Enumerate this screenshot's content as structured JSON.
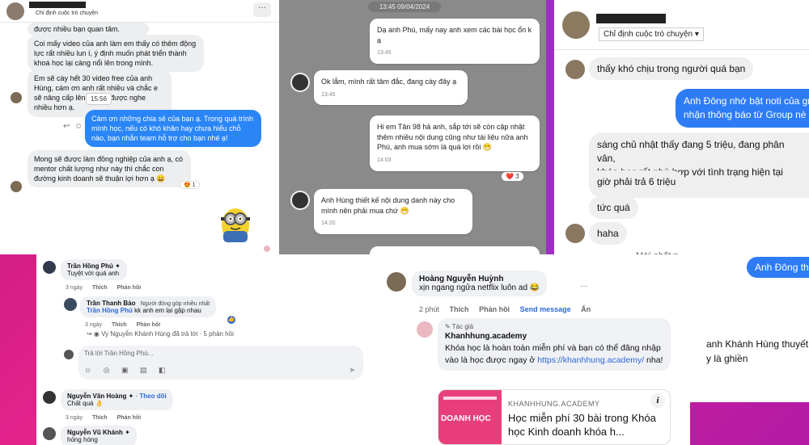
{
  "p1": {
    "subtitle": "Chỉ định cuộc trò chuyện",
    "more": "···",
    "m0": "được nhiều bạn quan tâm.",
    "m1": "Coi mấy video của anh làm em thấy có thêm động lực rất nhiều lun í, ý định muốn phát triển thành khoá học lại càng nổi lên trong mình.",
    "m2": "Em sẽ cày hết 30 video free của anh Hùng, cám ơn anh rất nhiều và chắc e sẽ nâng cấp lên pro để được nghe nhiều hơn ạ.",
    "tooltip": "15:56",
    "out": "Cảm ơn những chia sẻ của bạn ạ. Trong quá trình mình học, nếu có khó khăn hay chưa hiểu chỗ nào, bạn nhắn team hỗ trợ cho bạn nhé ạ!",
    "m3": "Mong sẽ được làm đồng nghiệp của anh ạ, có mentor chất lượng như này thì chắc con đường kinh doanh sẽ thuận lợi hơn ạ 😄",
    "react": "😍 1"
  },
  "p2": {
    "time": "13:45 09/04/2024",
    "b1": "Dạ anh Phú, mấy nay anh xem các bài học ổn k ạ",
    "t1": "13:45",
    "b2": "Ok lắm, mình rất tâm đắc, đang cày đây ạ",
    "t2": "13:45",
    "b3": "Hi em Tân 98 hả anh, sắp tới sẽ còn cập nhật thêm nhiều nội dung cũng như tài liệu nữa anh Phú, anh mua sớm là quá lợi rồi 😁",
    "t3": "14:03",
    "react": "❤️ 3",
    "b4": "Anh Hùng thiết kế nội dung danh này cho mình nên phải mua chứ 😁",
    "t4": "14:20"
  },
  "p3": {
    "subtitle": "Chỉ định cuộc trò chuyện ▾",
    "m1": "thấy khó chịu trong người quá bạn",
    "o1a": "Anh Đông nhớ bật noti của gr",
    "o1b": "nhận thông báo từ Group nè a",
    "m2a": "sáng chủ nhật thấy đang 5 triệu, đang phân vân,",
    "m2b": "khóa học rất phù hợp với tình trạng hiện tại của m",
    "m3": "giờ phải trả 6 triệu",
    "m4": "tức quá",
    "m5": "haha",
    "sep": "Mới nhất ▾"
  },
  "p4": {
    "c1_name": "Trần Hồng Phú",
    "c1_text": "Tuyệt vời quá anh",
    "c1_time": "3 ngày",
    "like": "Thích",
    "reply": "Phản hồi",
    "c2_name": "Trần Thanh Bảo",
    "c2_badge": "Người đóng góp nhiều nhất",
    "c2_tag": "Trần Hồng Phú",
    "c2_text": "kk anh em lại gặp nhau",
    "c2_time": "3 ngày",
    "view_replies": "Vy Nguyễn Khánh Hùng đã trả lời · 5 phản hồi",
    "input_ph": "Trả lời Trần Hồng Phú...",
    "input_icons": "☺ ◎ ▣ ▤ ◧",
    "send": "➤",
    "c3_name": "Nguyễn Văn Hoàng",
    "c3_follow": "Theo dõi",
    "c3_text": "Chất quá 👌",
    "c3_time": "3 ngày",
    "c4_name": "Nguyễn Vũ Khánh",
    "c4_text": "hóng hóng"
  },
  "p5": {
    "name": "Hoàng Nguyễn Huỳnh",
    "text": "xịn ngang ngửa netflix luôn ad 😂",
    "time": "2 phút",
    "like": "Thích",
    "reply": "Phản hồi",
    "send_msg": "Send message",
    "hide": "Ẩn",
    "author_tag": "✎ Tác giả",
    "author": "Khanhhung.academy",
    "reply_text": "Khóa học là hoàn toàn miễn phí và bạn có thể đăng nhập vào là học được ngay ở",
    "link": "https://khanhhung.academy/",
    "tail": " nha!",
    "card_site": "KHANHHUNG.ACADEMY",
    "card_title": "Học miễn phí 30 bài trong Khóa học Kinh doanh khóa h...",
    "thumb_title": "DOANH HỌC"
  },
  "p6": {
    "out": "Anh Đông tha",
    "t1": "anh Khánh Hùng thuyết",
    "t2": "y là ghiền"
  }
}
